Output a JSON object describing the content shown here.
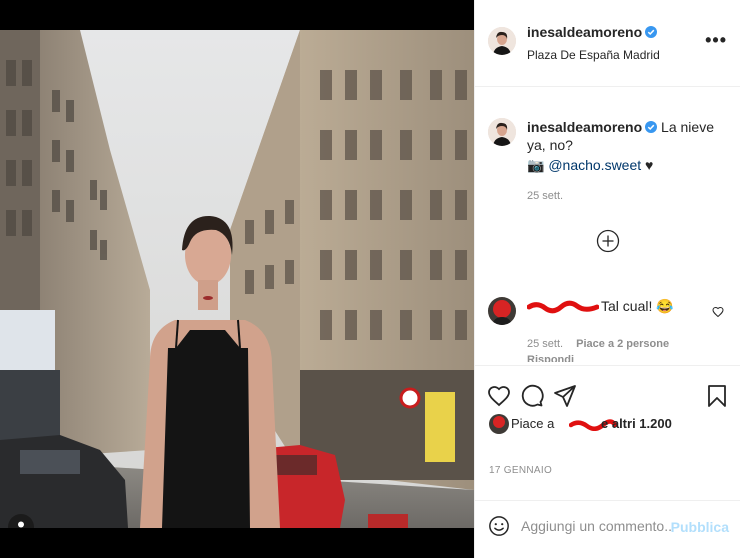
{
  "post": {
    "username": "inesaldeamoreno",
    "location": "Plaza De España Madrid",
    "more_label": "•••"
  },
  "caption": {
    "username": "inesaldeamoreno",
    "text": "La nieve ya, no?",
    "camera_emoji": "📷",
    "mention": "@nacho.sweet",
    "heart": "♥",
    "time": "25 sett."
  },
  "comment": {
    "text": "Tal cual! 😂",
    "time": "25 sett.",
    "likes": "Piace a 2 persone",
    "reply": "Rispondi"
  },
  "likes": {
    "prefix": "Piace a",
    "suffix": "e altri 1.200"
  },
  "date": "17 GENNAIO",
  "comment_box": {
    "placeholder": "Aggiungi un commento...",
    "publish": "Pubblica"
  },
  "icons": [
    "verified-icon",
    "more-icon",
    "camera-icon",
    "load-more-icon",
    "heart-icon",
    "comment-icon",
    "share-icon",
    "bookmark-icon",
    "emoji-icon",
    "user-tag-icon"
  ],
  "colors": {
    "verified": "#3897f0",
    "link": "#00376b",
    "publish_disabled": "#b2dffc",
    "redaction": "#e01010"
  }
}
